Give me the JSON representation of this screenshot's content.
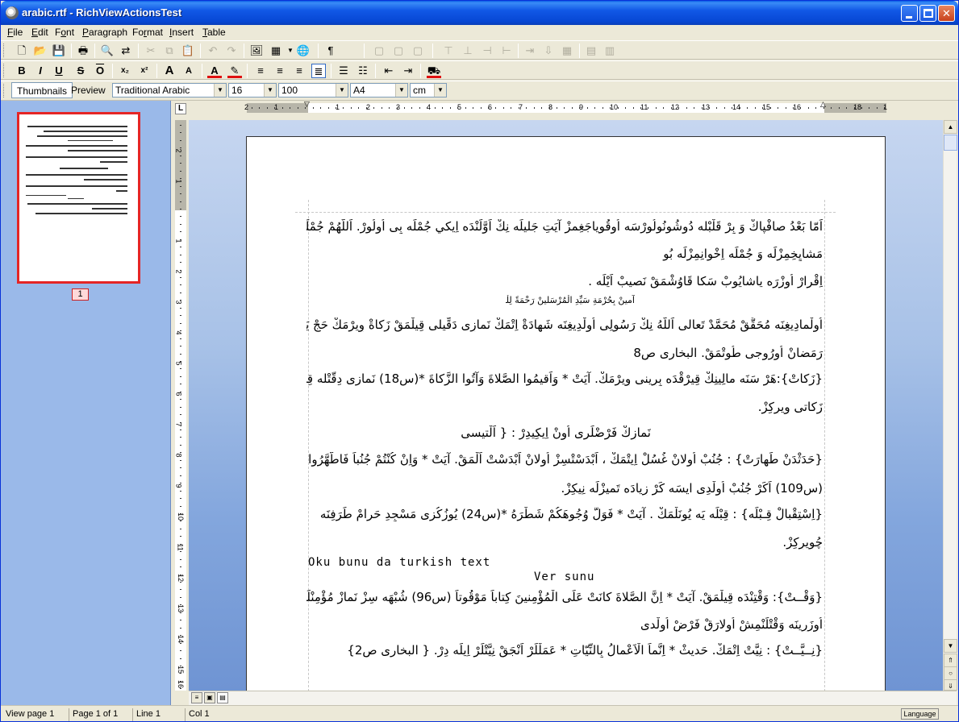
{
  "window": {
    "title": "arabic.rtf - RichViewActionsTest"
  },
  "menu": [
    "File",
    "Edit",
    "Font",
    "Paragraph",
    "Format",
    "Insert",
    "Table"
  ],
  "menu_access_keys": [
    "F",
    "E",
    "o",
    "P",
    "r",
    "I",
    "T"
  ],
  "toolbar3": {
    "thumbnails_label": "Thumbnails",
    "preview_label": "Preview",
    "font_name": "Traditional Arabic",
    "font_size": "16",
    "zoom": "100",
    "page_size": "A4",
    "units": "cm"
  },
  "thumbnail": {
    "page_number": "1"
  },
  "ruler": {
    "h_ticks": [
      "2",
      "1",
      "1",
      "2",
      "3",
      "4",
      "5",
      "6",
      "7",
      "8",
      "9",
      "10",
      "11",
      "12",
      "13",
      "14",
      "15",
      "16",
      "18",
      "1"
    ],
    "v_ticks": [
      "2",
      "1",
      "1",
      "2",
      "3",
      "4",
      "5",
      "6",
      "7",
      "8",
      "9",
      "10",
      "11",
      "12",
      "13",
      "14",
      "15",
      "16"
    ],
    "corner_label": "L"
  },
  "document": {
    "lines": [
      "اَمّا بَعْدُ صافْپاكْ وَ بِرْ قَلْبْله دُوشُونُولُورْسَه اُوقُوياجَغِمزْ آيَتِ جَليلَه نِكْ اَوَّلَنْدَه اِيكي جُمْلَه بِى اُولُورْ. اَللّهُمْ جُمْلَه مِزى",
      "مَشايِخِمِزْلَه وَ جُمْلَه اِخْوانِمِزْلَه بُو",
      "اِقْرارْ اُوزْرَه ياشايُوبْ سَكا قَاوُشْمَقْ نَصيبْ اَيْلَه .",
      "آمينْ بِحُرْمَةِ سَيِّدِ الْمُرْسَلينْ رَحْمَةً لِلْعالَمينْ",
      "اُولْمادِيغِنَه مُحَقَّقْ مُحَمَّدْ تَعالى اَللّهُ نِكْ رَسُولِى اُولْدِيغِنَه شَهادَةْ اِتْمَكْ نَمازِى دَقِّيلى قِيلْمَقْ زَكاةْ وِيرْمَكْ حَجْ يَمَقْ",
      "رَمَضانْ اُورُوجى طُوتْمَقْ. البخارى ص8",
      "{زَكاتْ}:هَرْ سَنَه مالِينِكْ قِيرْقْدَه بِرِينى وِيرْمَكْ. آيَتْ * وَاَقيمُوا الصَّلاةَ وَآتُوا الزَّكاةَ *(س18) نَمازى دِقَّتْله قِيلِيكِزْ",
      "زَكاتى وِيرِكِزْ.",
      "نَمازِكْ فَرْضْلَرى اُونْ اِيكِيدِرْ : { اَلْتيسى طِيشِنْدَه دِرْ }",
      "{حَدَثْدَنْ طَهارَتْ} : جُنُبْ اُولانْ غُسُلْ اِيتْمَكْ ، اَبْدَسْتْسِزْ اُولانْ اَبْدَسْتْ اَلْمَقْ. آيَتْ * وَاِنْ كُنْتُمْ جُنُباً فَاطَّهَّرُوا *",
      "(س109) اَكَرْ جُنُبْ اُولْدِى ايسَه كَرْ زِيادَه تَميزْلَه نِيكِزْ.",
      "{اِسْتِقْبالْ قِـبْلَه} : قِبْلَه يَه يُونَلْمَكْ . آيَتْ * فَوَلُّ وُجُوهَكُمْ شَطْرَهُ *(س24) يُوزُكُزى مَسْجِدِ حَرامْ طَرَفِنَه",
      "چُويرِكِزْ.",
      "Oku bunu da turkish text",
      "Ver sunu",
      "{وَقْــتْ}: وَقْتِنْدَه قِيلْمَقْ. آيَتْ * اِنَّ الصَّلاةَ كانَتْ عَلَى الْمُؤْمِنينَ كِتاباً مَوْقُوتاً (س96) شُبْهَه سِزْ نَمازْ مُؤْمِنْلَرْ",
      "اُوزَرِينَه وَقْتْلَنْمِشْ اُولارَقْ فَرْضْ اُولْدى",
      "{نِــيَّــتْ} : نِيَّتْ اِتْمَكْ. حَديثْ * اِنَّماَ الْاَعْمالُ بِالنِّيّاتِ * عَمَلْلَرْ اَنْجَقْ نِيَّتْلَرْ اِيلَه دِرْ. { البخارى ص2}"
    ]
  },
  "status": {
    "view_page": "View page 1",
    "page_of": "Page 1 of 1",
    "line": "Line 1",
    "col": "Col 1",
    "language_button": "Language"
  }
}
